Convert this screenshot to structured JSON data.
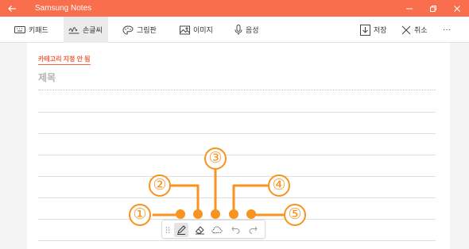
{
  "titlebar": {
    "title": "Samsung Notes",
    "color": "#f96e4c"
  },
  "toolbar": {
    "keyboard_label": "키패드",
    "handwriting_label": "손글씨",
    "drawing_label": "그림판",
    "image_label": "이미지",
    "voice_label": "음성",
    "save_label": "저장",
    "cancel_label": "취소",
    "more_label": "···"
  },
  "page": {
    "category_label": "카테고리 지정 안 됨",
    "title_placeholder": "제목"
  },
  "pen_toolbar": {
    "tools": [
      "pen-icon",
      "eraser-icon",
      "lasso-icon",
      "undo-icon",
      "redo-icon"
    ],
    "selected_tool": "pen-icon"
  },
  "annotations": {
    "color": "#f7931e",
    "callouts": [
      "①",
      "②",
      "③",
      "④",
      "⑤"
    ]
  }
}
